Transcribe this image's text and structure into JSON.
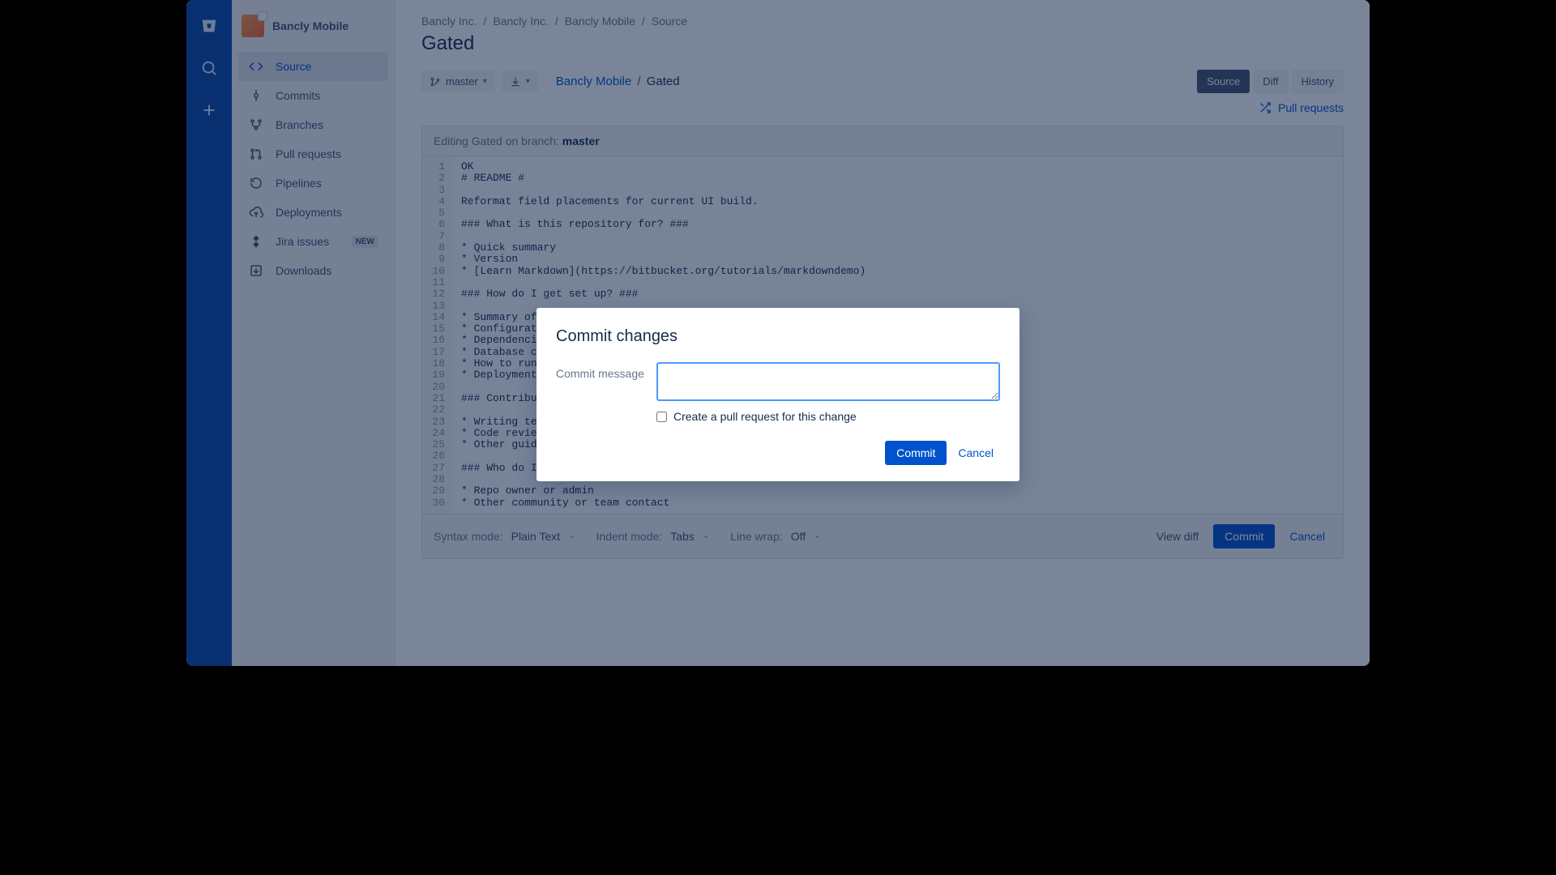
{
  "project": {
    "name": "Bancly Mobile"
  },
  "breadcrumbs": [
    "Bancly Inc.",
    "Bancly Inc.",
    "Bancly Mobile",
    "Source"
  ],
  "page_title": "Gated",
  "branch_selector": "master",
  "repo_path": {
    "repo": "Bancly Mobile",
    "file": "Gated"
  },
  "view_tabs": {
    "source": "Source",
    "diff": "Diff",
    "history": "History"
  },
  "pr_link": "Pull requests",
  "sidebar": {
    "items": [
      {
        "label": "Source"
      },
      {
        "label": "Commits"
      },
      {
        "label": "Branches"
      },
      {
        "label": "Pull requests"
      },
      {
        "label": "Pipelines"
      },
      {
        "label": "Deployments"
      },
      {
        "label": "Jira issues",
        "badge": "NEW"
      },
      {
        "label": "Downloads"
      }
    ]
  },
  "editor": {
    "heading_prefix": "Editing Gated on branch:",
    "branch": "master",
    "lines": [
      "OK",
      "# README #",
      "",
      "Reformat field placements for current UI build.",
      "",
      "### What is this repository for? ###",
      "",
      "* Quick summary",
      "* Version",
      "* [Learn Markdown](https://bitbucket.org/tutorials/markdowndemo)",
      "",
      "### How do I get set up? ###",
      "",
      "* Summary of set up",
      "* Configuration",
      "* Dependencies",
      "* Database configuration",
      "* How to run tests",
      "* Deployment instructions",
      "",
      "### Contribution guidelines ###",
      "",
      "* Writing tests",
      "* Code review",
      "* Other guidelines",
      "",
      "### Who do I talk to? ###",
      "",
      "* Repo owner or admin",
      "* Other community or team contact"
    ]
  },
  "footer": {
    "syntax_label": "Syntax mode:",
    "syntax_value": "Plain Text",
    "indent_label": "Indent mode:",
    "indent_value": "Tabs",
    "wrap_label": "Line wrap:",
    "wrap_value": "Off",
    "view_diff": "View diff",
    "commit": "Commit",
    "cancel": "Cancel"
  },
  "modal": {
    "title": "Commit changes",
    "message_label": "Commit message",
    "message_value": "",
    "pr_checkbox_label": "Create a pull request for this change",
    "commit": "Commit",
    "cancel": "Cancel"
  }
}
